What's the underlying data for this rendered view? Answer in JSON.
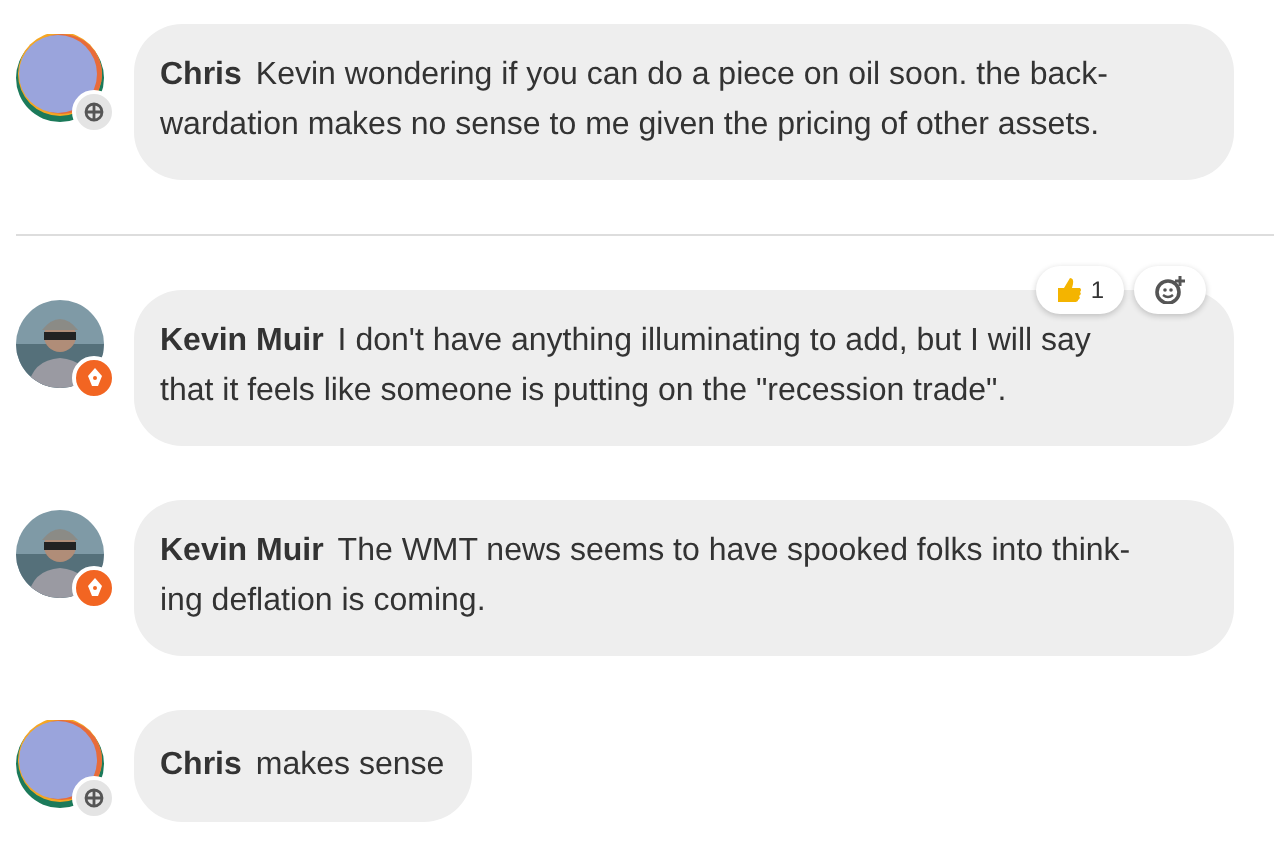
{
  "groups": [
    {
      "messages": [
        {
          "author": "Chris",
          "avatar": {
            "kind": "abstract",
            "badge": {
              "kind": "member"
            }
          },
          "text": "Kevin wondering if you can do a piece on oil soon. the back-\nwardation makes no sense to me given the pricing of other assets."
        }
      ]
    },
    {
      "messages": [
        {
          "author": "Kevin Muir",
          "avatar": {
            "kind": "picture",
            "badge": {
              "kind": "author"
            }
          },
          "text": "I don't have anything illuminating to add, but I will say\nthat it feels like someone is putting on the \"recession trade\".",
          "reactions": [
            {
              "kind": "thumbs-up",
              "count": "1"
            }
          ]
        },
        {
          "author": "Kevin Muir",
          "avatar": {
            "kind": "picture",
            "badge": {
              "kind": "author"
            }
          },
          "text": "The WMT news seems to have spooked folks into think-\ning deflation is coming."
        },
        {
          "author": "Chris",
          "avatar": {
            "kind": "abstract",
            "badge": {
              "kind": "member"
            }
          },
          "text": "makes sense"
        }
      ]
    }
  ]
}
